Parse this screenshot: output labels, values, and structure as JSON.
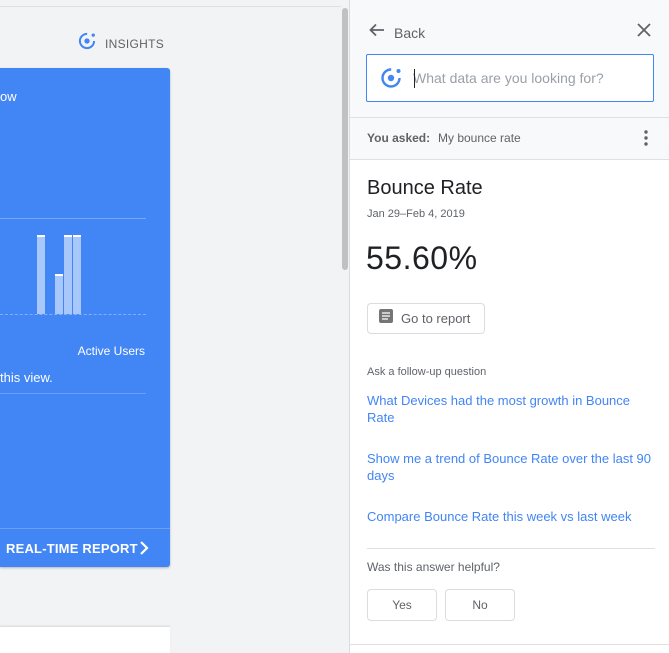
{
  "dashboard": {
    "insights_label": "INSIGHTS",
    "card_title_fragment": "ow",
    "bars": [
      0.82,
      0.42,
      0.82,
      0.82
    ],
    "active_users_label": "Active Users",
    "view_fragment": "this view.",
    "realtime_label": "REAL-TIME REPORT"
  },
  "panel": {
    "back_label": "Back",
    "search_placeholder": "What data are you looking for?",
    "you_asked_label": "You asked:",
    "question": "My bounce rate",
    "metric_name": "Bounce Rate",
    "date_range": "Jan 29–Feb 4, 2019",
    "metric_value": "55.60%",
    "goto_label": "Go to report",
    "follow_up_label": "Ask a follow-up question",
    "follow_ups": [
      "What Devices had the most growth in Bounce Rate",
      "Show me a trend of Bounce Rate over the last 90 days",
      "Compare Bounce Rate this week vs last week"
    ],
    "helpful_label": "Was this answer helpful?",
    "yes_label": "Yes",
    "no_label": "No"
  },
  "colors": {
    "accent": "#4285f4",
    "text": "#202124",
    "muted": "#5f6368"
  }
}
